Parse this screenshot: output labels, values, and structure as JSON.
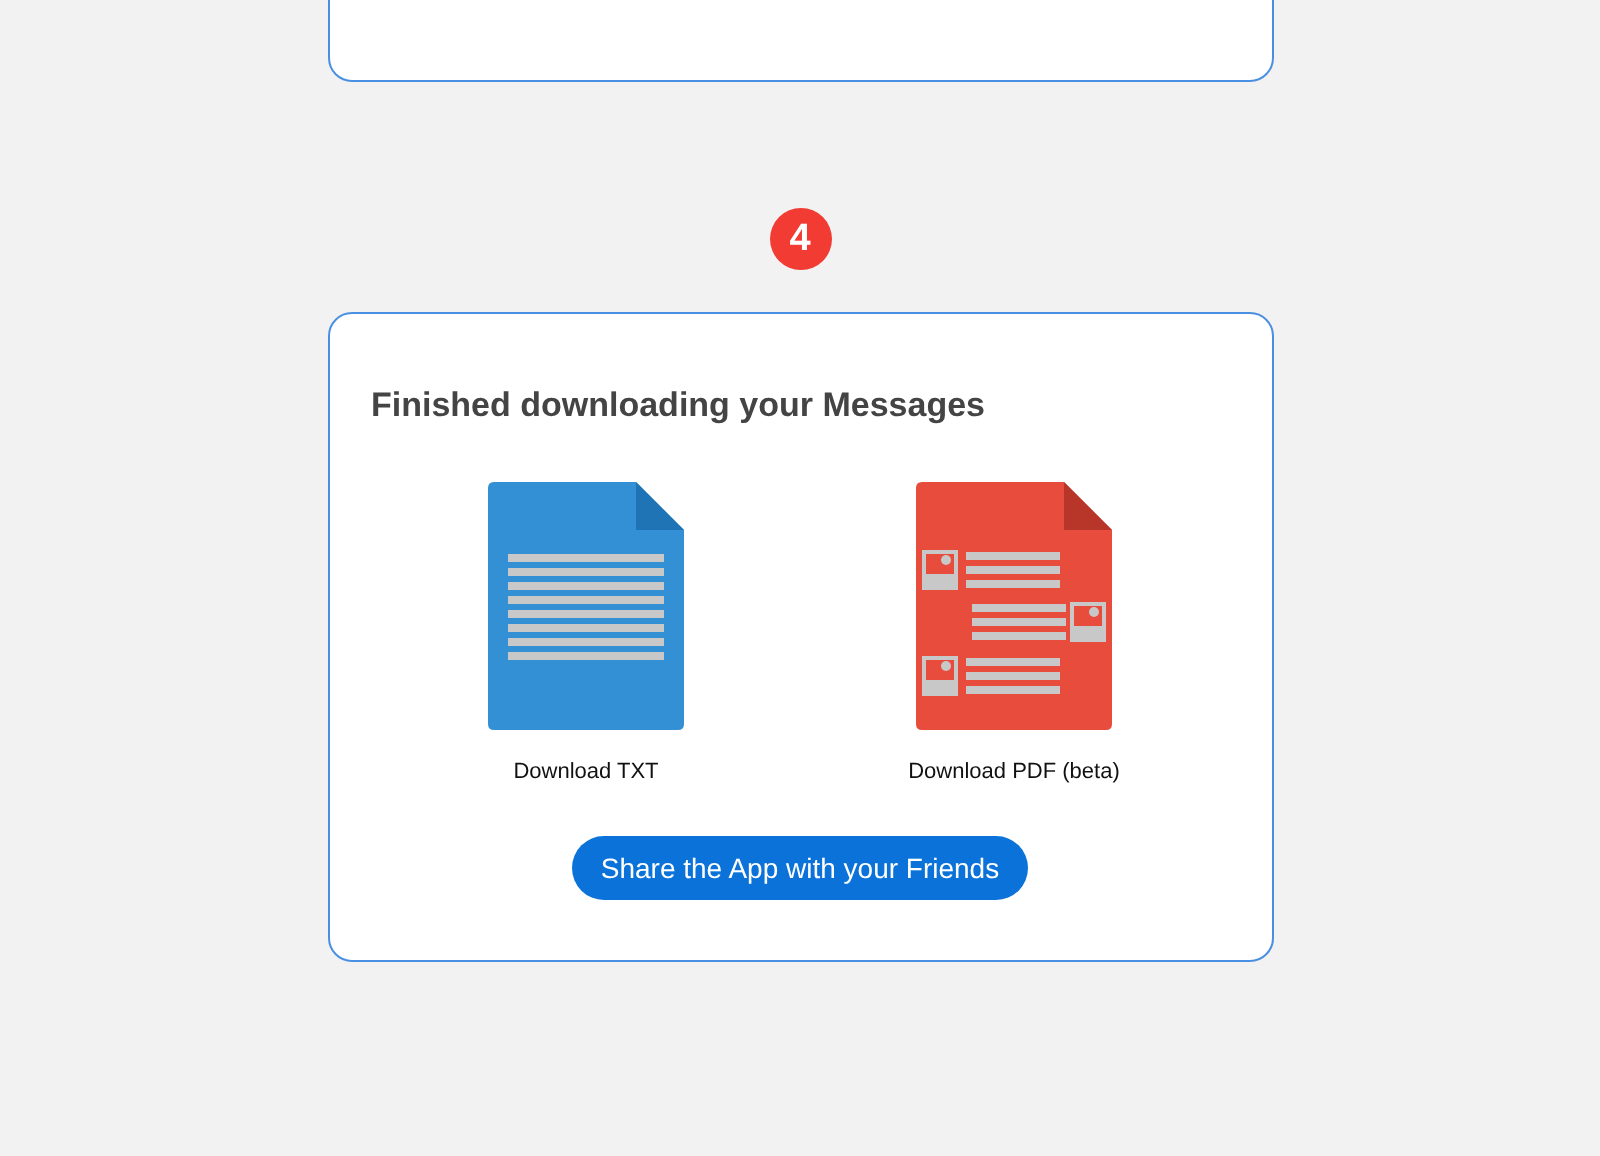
{
  "step_badge": "4",
  "card": {
    "title": "Finished downloading your Messages",
    "downloads": [
      {
        "kind": "txt",
        "label": "Download TXT"
      },
      {
        "kind": "pdf",
        "label": "Download PDF (beta)"
      }
    ],
    "share_button": "Share the App with your Friends"
  }
}
